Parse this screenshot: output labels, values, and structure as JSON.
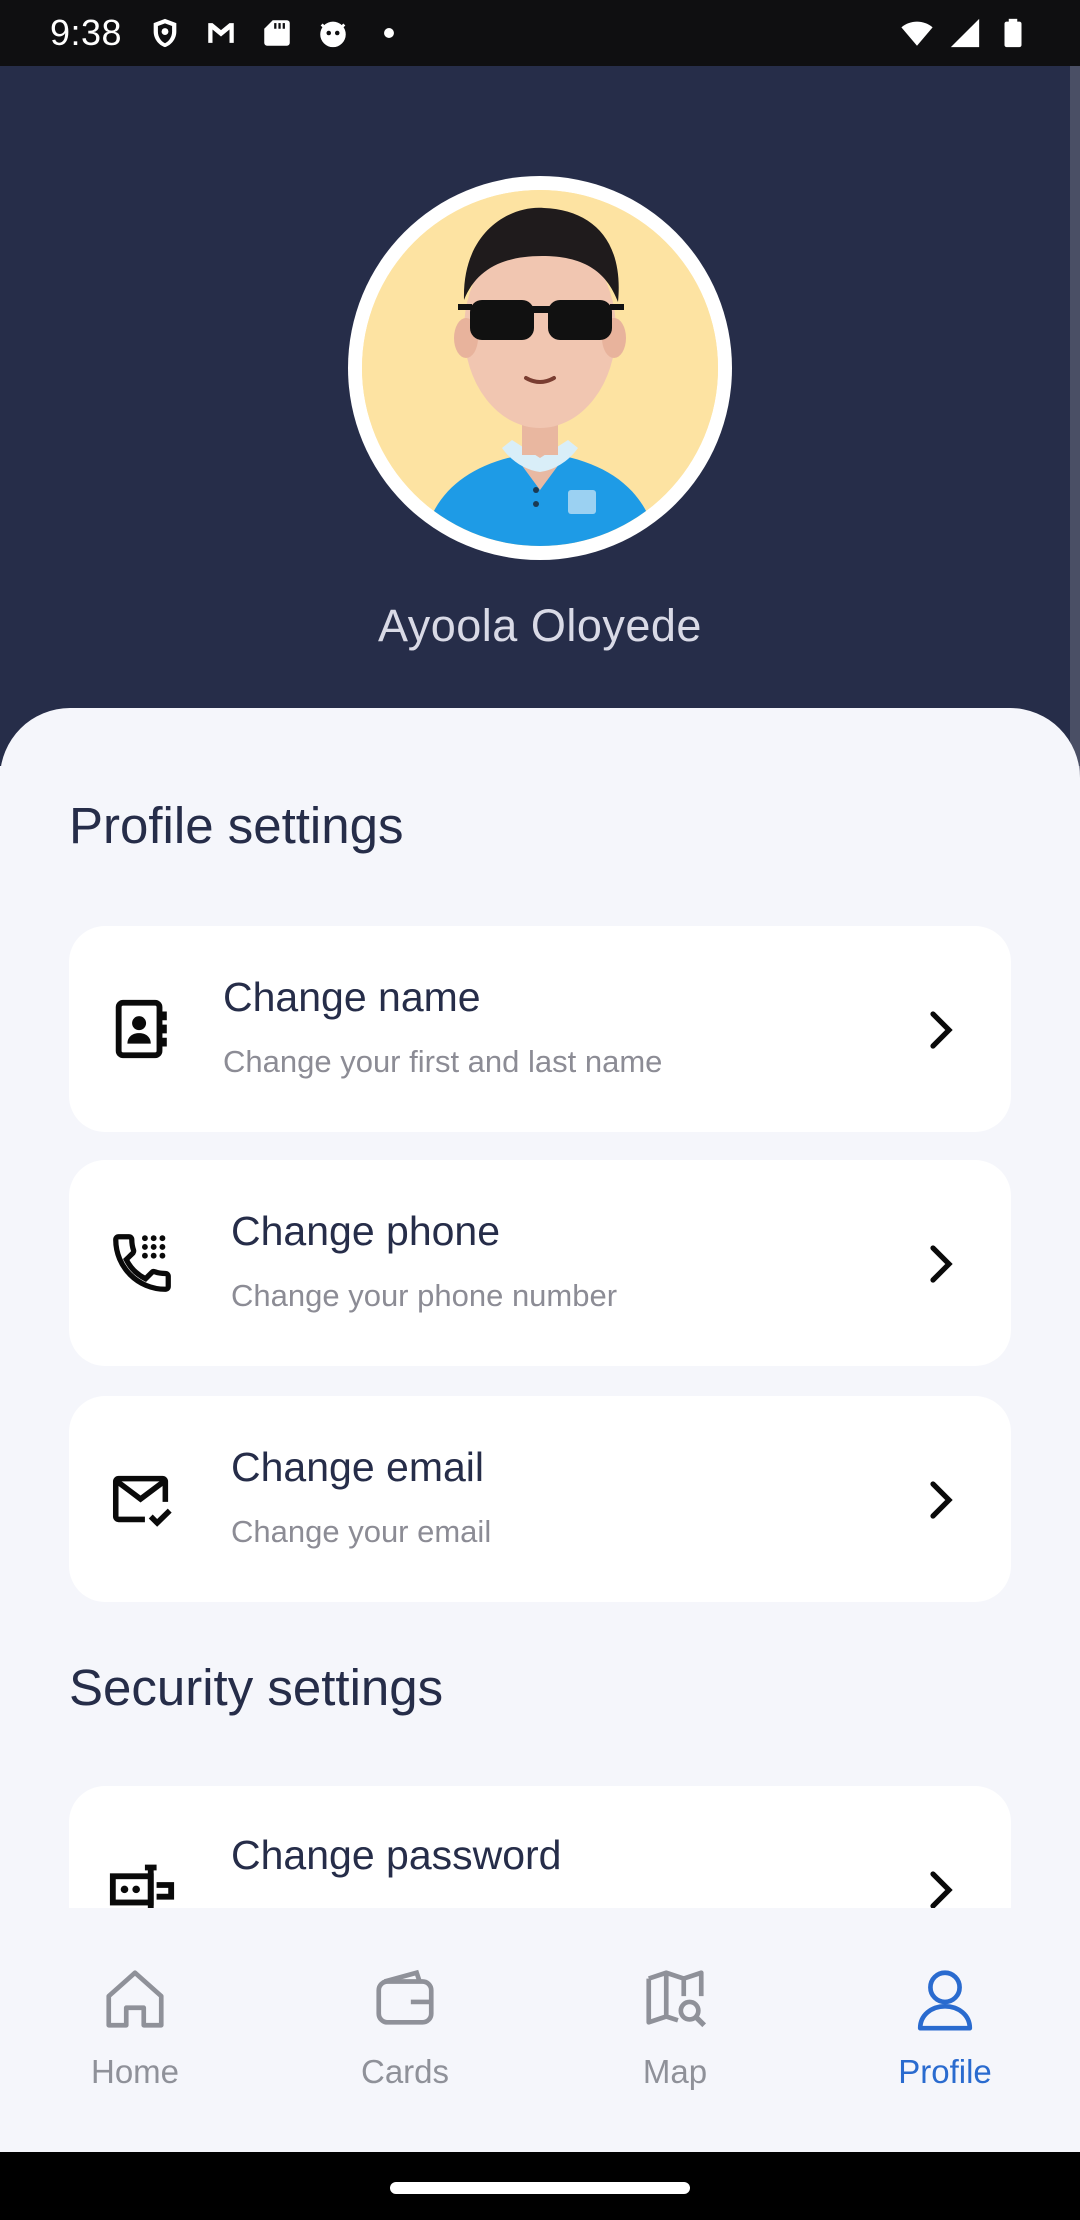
{
  "status_bar": {
    "time": "9:38",
    "left_icons": [
      "shield-icon",
      "gmail-icon",
      "sd-card-icon",
      "cat-icon",
      "dot-icon"
    ],
    "right_icons": [
      "wifi-icon",
      "signal-icon",
      "battery-icon"
    ]
  },
  "profile": {
    "name": "Ayoola Oloyede",
    "avatar": "avatar-icon"
  },
  "sections": {
    "profile_title": "Profile settings",
    "security_title": "Security settings"
  },
  "items": [
    {
      "title": "Change name",
      "subtitle": "Change your first and last name",
      "icon": "contact-book-icon"
    },
    {
      "title": "Change phone",
      "subtitle": "Change your phone number",
      "icon": "phone-dialpad-icon"
    },
    {
      "title": "Change email",
      "subtitle": "Change your email",
      "icon": "mail-check-icon"
    },
    {
      "title": "Change password",
      "subtitle": "",
      "icon": "password-key-icon"
    }
  ],
  "nav": [
    {
      "label": "Home",
      "icon": "home-icon",
      "active": false
    },
    {
      "label": "Cards",
      "icon": "wallet-icon",
      "active": false
    },
    {
      "label": "Map",
      "icon": "map-search-icon",
      "active": false
    },
    {
      "label": "Profile",
      "icon": "user-icon",
      "active": true
    }
  ],
  "colors": {
    "header_bg": "#262d49",
    "accent_active": "#2a6bcf",
    "page_bg": "#f5f6fb"
  }
}
